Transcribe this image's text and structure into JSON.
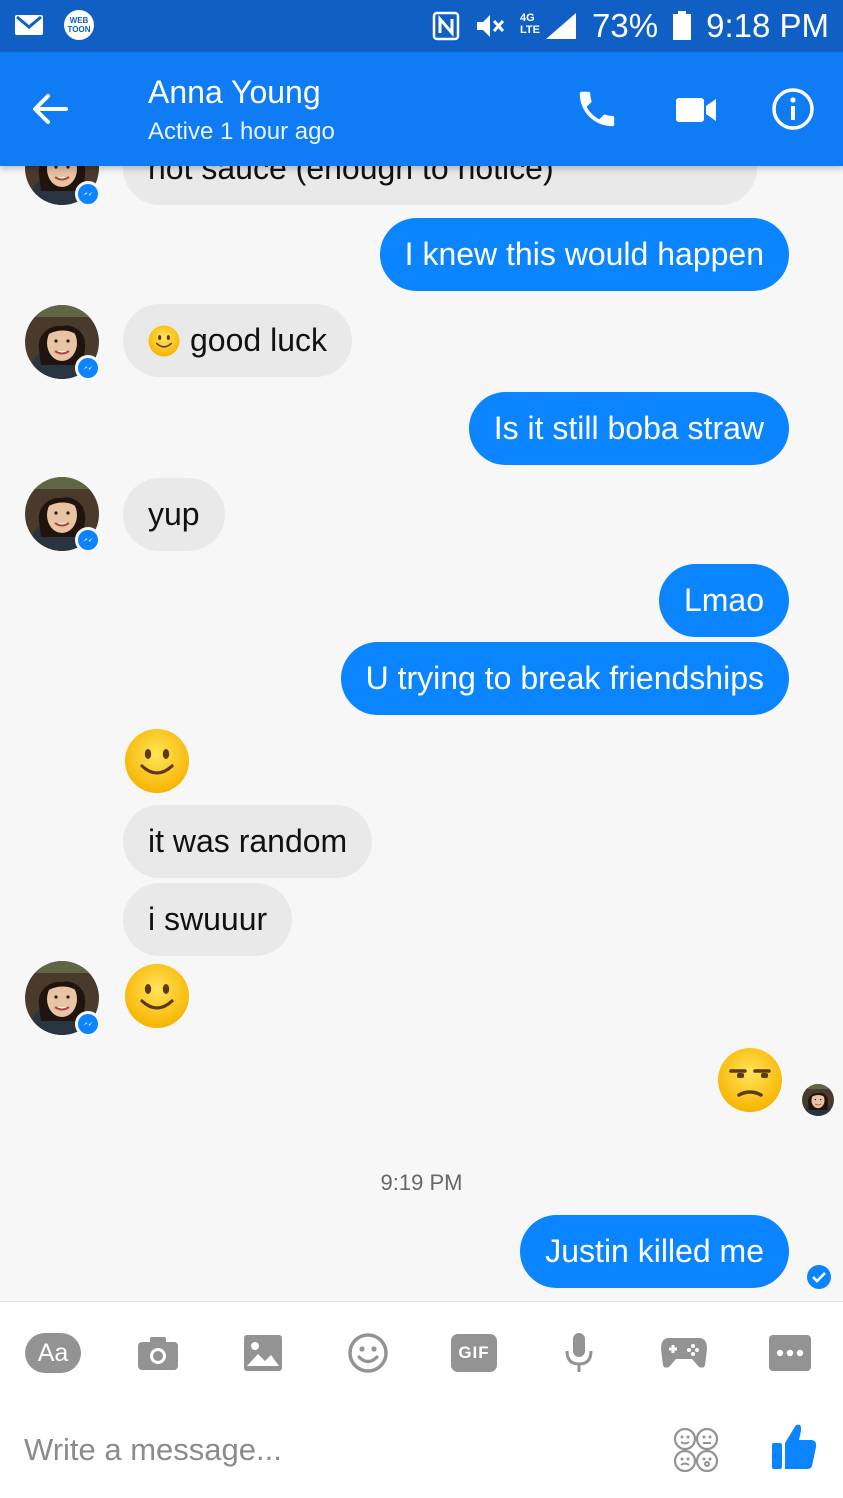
{
  "status_bar": {
    "battery": "73%",
    "time": "9:18 PM",
    "network": "4G LTE",
    "webtoon": "WEB TOON",
    "icons": [
      "gmail-icon",
      "webtoon-icon",
      "nfc-icon",
      "muted-icon",
      "signal-icon",
      "battery-icon"
    ]
  },
  "header": {
    "back_icon": "arrow-left-icon",
    "contact_name": "Anna Young",
    "contact_status": "Active 1 hour ago",
    "actions": [
      "phone-icon",
      "video-camera-icon",
      "info-icon"
    ]
  },
  "messages": [
    {
      "from": "them",
      "text": "hot sauce (enough to notice)"
    },
    {
      "from": "me",
      "text": "I knew this would happen"
    },
    {
      "from": "them",
      "text": "good luck",
      "emoji": "slight-smile"
    },
    {
      "from": "me",
      "text": "Is it still boba straw"
    },
    {
      "from": "them",
      "text": "yup"
    },
    {
      "from": "me",
      "text": "Lmao"
    },
    {
      "from": "me",
      "text": "U trying to break friendships"
    },
    {
      "from": "them",
      "emoji": "slight-smile"
    },
    {
      "from": "them",
      "text": "it was random"
    },
    {
      "from": "them",
      "text": "i swuuur"
    },
    {
      "from": "them",
      "emoji": "slight-smile"
    },
    {
      "from": "me",
      "emoji": "unamused"
    },
    {
      "timestamp": "9:19 PM"
    },
    {
      "from": "me",
      "text": "Justin killed me",
      "status": "delivered"
    }
  ],
  "toolbar": {
    "text_label": "Aa",
    "gif_label": "GIF",
    "icons": [
      "text-icon",
      "camera-icon",
      "image-icon",
      "emoji-icon",
      "gif-icon",
      "microphone-icon",
      "game-controller-icon",
      "more-icon"
    ]
  },
  "composer": {
    "placeholder": "Write a message...",
    "icons": [
      "stickers-icon",
      "thumbs-up-icon"
    ]
  },
  "colors": {
    "status_bar": "#0f5fc4",
    "app_bar": "#0f7bf4",
    "outgoing_bubble": "#0b84ff",
    "incoming_bubble": "#e9e9e9",
    "toolbar_icon": "#939393"
  }
}
